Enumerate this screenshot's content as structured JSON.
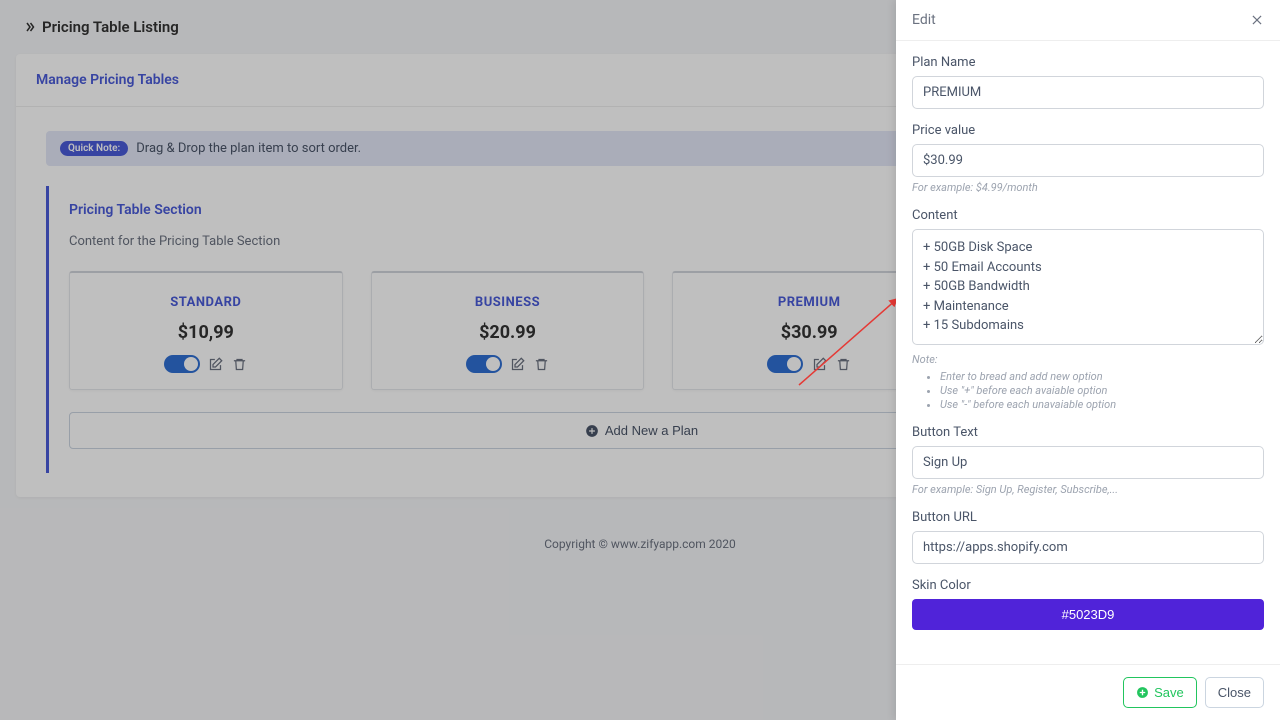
{
  "header": {
    "title": "Pricing Table Listing"
  },
  "card": {
    "title": "Manage Pricing Tables",
    "note_pill": "Quick Note:",
    "note_text": "Drag & Drop the plan item to sort order.",
    "section_title": "Pricing Table Section",
    "section_sub": "Content for the Pricing Table Section",
    "add_label": "Add New a Plan"
  },
  "plans": [
    {
      "name": "STANDARD",
      "price": "$10,99"
    },
    {
      "name": "BUSINESS",
      "price": "$20.99"
    },
    {
      "name": "PREMIUM",
      "price": "$30.99"
    }
  ],
  "footer": {
    "text": "Copyright © www.zifyapp.com 2020"
  },
  "drawer": {
    "title": "Edit",
    "plan_name_label": "Plan Name",
    "plan_name_value": "PREMIUM",
    "price_label": "Price value",
    "price_value": "$30.99",
    "price_hint": "For example: $4.99/month",
    "content_label": "Content",
    "content_value": "+ 50GB Disk Space\n+ 50 Email Accounts\n+ 50GB Bandwidth\n+ Maintenance\n+ 15 Subdomains",
    "content_note_label": "Note:",
    "content_notes": [
      "Enter to bread and add new option",
      "Use \"+\" before each avaiable option",
      "Use \"-\" before each unavaiable option"
    ],
    "btn_text_label": "Button Text",
    "btn_text_value": "Sign Up",
    "btn_text_hint": "For example: Sign Up, Register, Subscribe,...",
    "btn_url_label": "Button URL",
    "btn_url_value": "https://apps.shopify.com",
    "skin_label": "Skin Color",
    "skin_value": "#5023D9",
    "save": "Save",
    "close": "Close"
  }
}
